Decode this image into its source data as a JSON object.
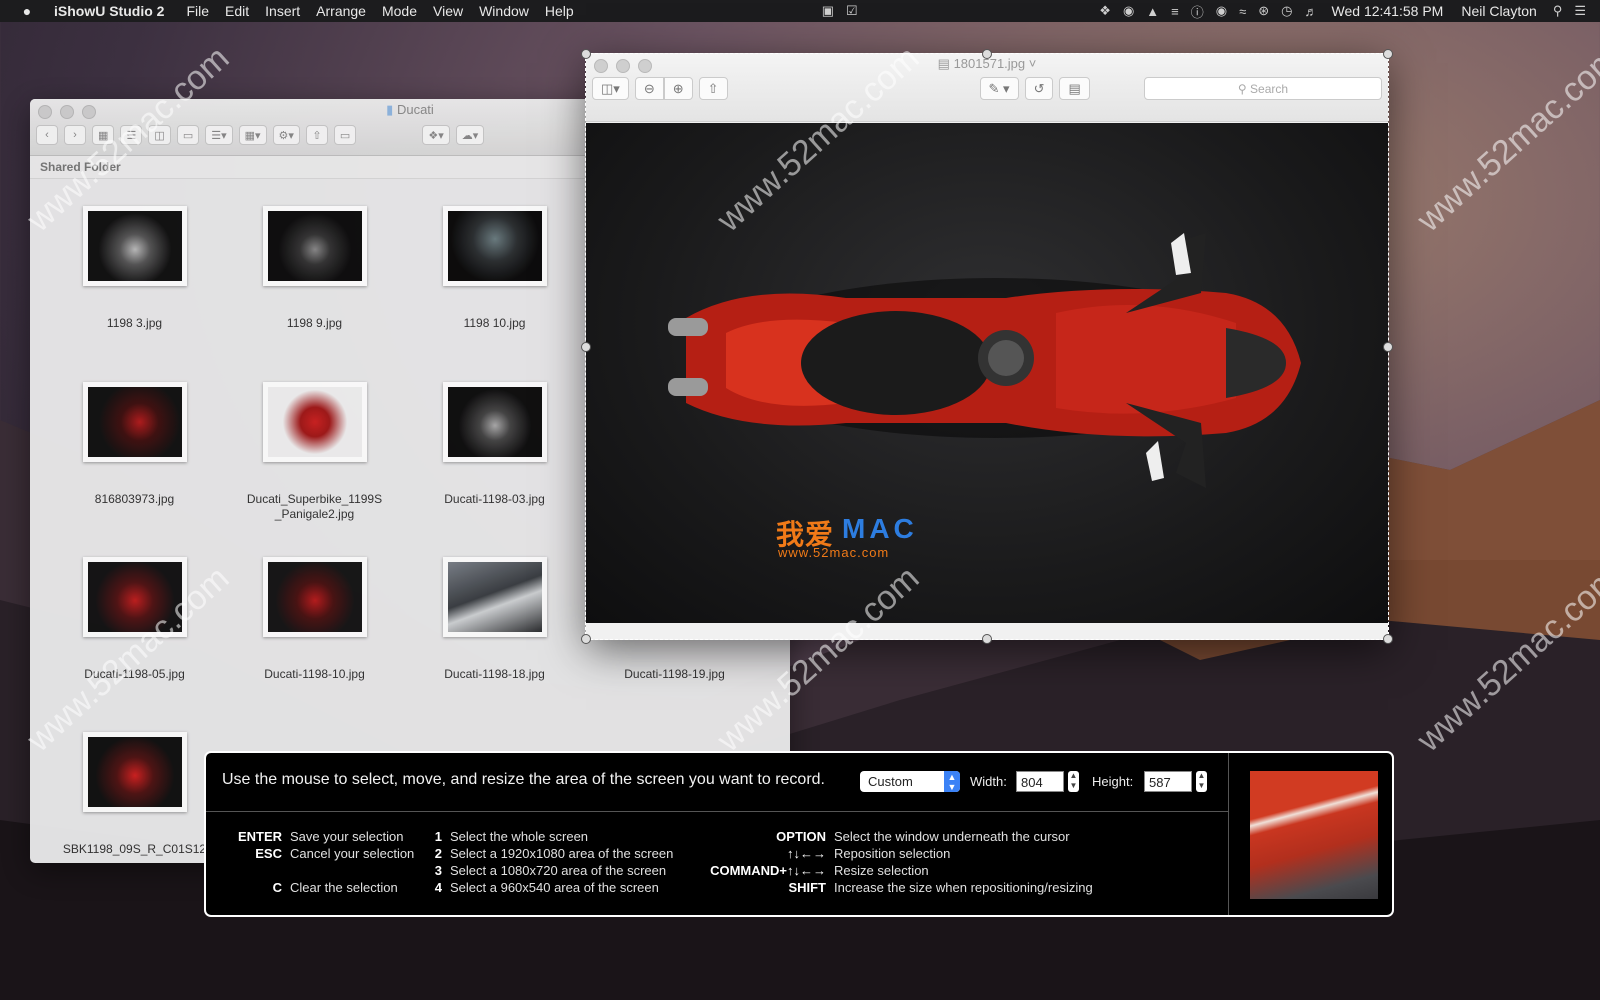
{
  "menubar": {
    "app": "iShowU Studio 2",
    "items": [
      "File",
      "Edit",
      "Insert",
      "Arrange",
      "Mode",
      "View",
      "Window",
      "Help"
    ],
    "clock": "Wed 12:41:58 PM",
    "user": "Neil Clayton"
  },
  "finder": {
    "title": "Ducati",
    "section": "Shared Folder",
    "files": [
      {
        "name": "1198 3.jpg"
      },
      {
        "name": "1198 9.jpg"
      },
      {
        "name": "1198 10.jpg"
      },
      {
        "name": "816803973.jpg"
      },
      {
        "name": "Ducati_Superbike_1199S _Panigale2.jpg"
      },
      {
        "name": "Ducati-1198-03.jpg"
      },
      {
        "name": "Ducati-1198-05.jpg"
      },
      {
        "name": "Ducati-1198-10.jpg"
      },
      {
        "name": "Ducati-1198-18.jpg"
      },
      {
        "name": "Ducati-1198-19.jpg"
      },
      {
        "name": "SBK1198_09S_R_C01S12"
      }
    ]
  },
  "preview": {
    "title": "1801571.jpg",
    "search_placeholder": "Search",
    "logo_cn": "我爱",
    "logo_mac": "MAC",
    "logo_url": "www.52mac.com"
  },
  "watermark": "www.52mac.com",
  "panel": {
    "instruction": "Use the mouse to select, move, and resize the area of the screen you want to record.",
    "preset": "Custom",
    "width_label": "Width:",
    "width_value": "804",
    "height_label": "Height:",
    "height_value": "587",
    "shortcuts_left": [
      {
        "key": "ENTER",
        "desc": "Save your selection"
      },
      {
        "key": "ESC",
        "desc": "Cancel your selection"
      },
      {
        "key": "",
        "desc": ""
      },
      {
        "key": "C",
        "desc": "Clear the selection"
      }
    ],
    "shortcuts_mid": [
      {
        "key": "1",
        "desc": "Select the whole screen"
      },
      {
        "key": "2",
        "desc": "Select a 1920x1080 area of the screen"
      },
      {
        "key": "3",
        "desc": "Select a 1080x720 area of the screen"
      },
      {
        "key": "4",
        "desc": "Select a 960x540 area of the screen"
      }
    ],
    "shortcuts_right": [
      {
        "key": "OPTION",
        "desc": "Select the window underneath the cursor"
      },
      {
        "key": "↑↓←→",
        "desc": "Reposition selection"
      },
      {
        "key": "COMMAND+↑↓←→",
        "desc": "Resize selection"
      },
      {
        "key": "SHIFT",
        "desc": "Increase the size when repositioning/resizing"
      }
    ]
  }
}
